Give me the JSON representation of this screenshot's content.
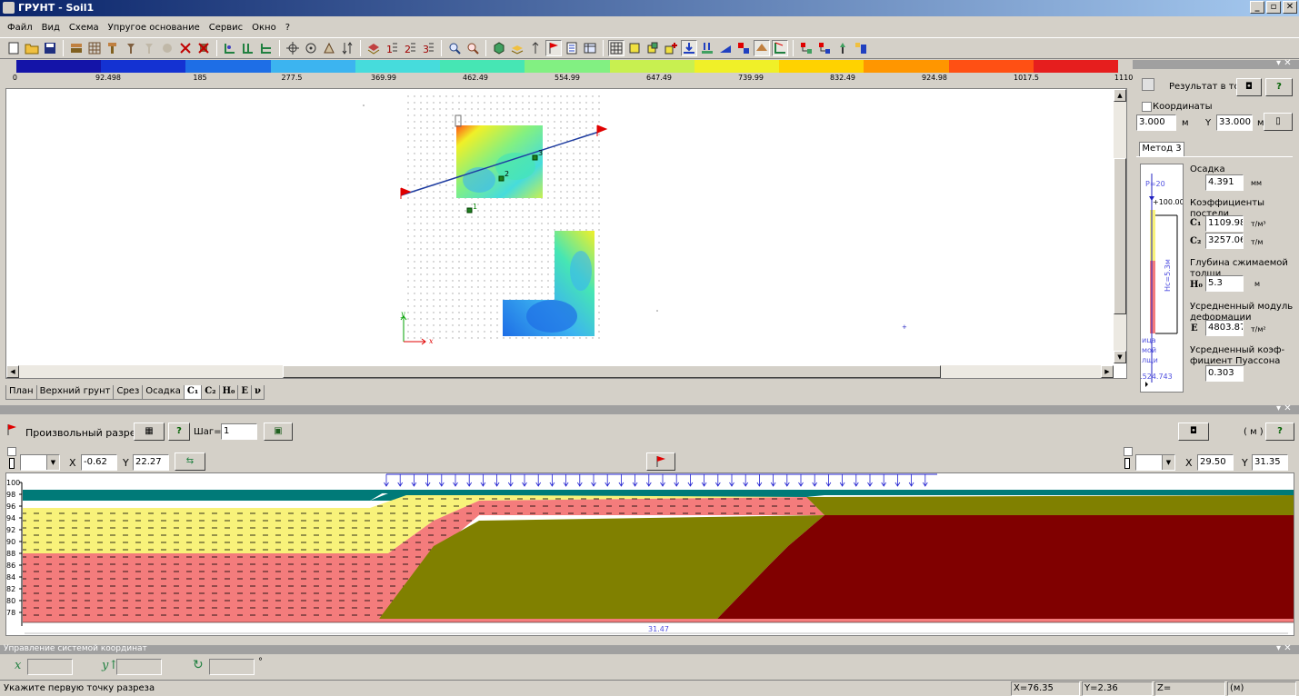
{
  "window": {
    "title": "ГРУНТ - Soil1",
    "min": "_",
    "max": "▫",
    "close": "✕"
  },
  "menu": [
    "Файл",
    "Вид",
    "Схема",
    "Упругое основание",
    "Сервис",
    "Окно",
    "?"
  ],
  "scale": {
    "colors": [
      "#1414a8",
      "#1432d2",
      "#1e6ee6",
      "#3cb4f0",
      "#46dcdc",
      "#46e6b4",
      "#82f082",
      "#c8f050",
      "#f0f028",
      "#ffd200",
      "#ff9600",
      "#ff5014",
      "#e61e1e"
    ],
    "labels": [
      "0",
      "92.498",
      "185",
      "277.5",
      "369.99",
      "462.49",
      "554.99",
      "647.49",
      "739.99",
      "832.49",
      "924.98",
      "1017.5",
      "1110"
    ]
  },
  "plan": {
    "point_labels": [
      "1",
      "2",
      "3"
    ],
    "axis_x": "x",
    "axis_y": "y"
  },
  "tabs_top": [
    "План",
    "Верхний грунт",
    "Срез",
    "Осадка",
    "C₁",
    "C₂",
    "H₀",
    "E",
    "ν"
  ],
  "right_panel": {
    "result_label": "Результат в то",
    "help": "?",
    "coords_label": "Координаты",
    "x_value": "3.000",
    "x_unit": "м",
    "y_label": "Y",
    "y_value": "33.000",
    "y_unit": "м",
    "method_tab": "Метод 3",
    "diagram": {
      "p_label": "P=20",
      "level": "+100.00",
      "hc_label": "Hc=5.3м",
      "lower_text": [
        "ица",
        "мой",
        "лщи"
      ],
      "bottom_value": "9.524.743"
    },
    "settlement_label": "Осадка",
    "settlement_value": "4.391",
    "settlement_unit": "мм",
    "coef_label": "Коэффициенты постели",
    "c1_label": "C₁",
    "c1_value": "1109.981",
    "c1_unit": "т/м³",
    "c2_label": "C₂",
    "c2_value": "3257.064",
    "c2_unit": "т/м",
    "depth_label": "Глубина сжимаемой толщи",
    "h0_label": "H₀",
    "h0_value": "5.3",
    "h0_unit": "м",
    "modulus_label": "Усредненный модуль деформации",
    "e_label": "E",
    "e_value": "4803.876",
    "e_unit": "т/м²",
    "poisson_label": "Усредненный коэф-фициент Пуассона",
    "poisson_value": "0.303"
  },
  "section": {
    "title": "Произвольный разрез",
    "step_label": "Шаг=",
    "step_value": "1",
    "unit_label": "( м )",
    "help": "?",
    "left_x_label": "X",
    "left_x": "-0.62",
    "left_y_label": "Y",
    "left_y": "22.27",
    "right_x_label": "X",
    "right_x": "29.50",
    "right_y_label": "Y",
    "right_y": "31.35",
    "y_ticks": [
      "100",
      "98",
      "96",
      "94",
      "92",
      "90",
      "88",
      "86",
      "84",
      "82",
      "80",
      "78"
    ],
    "length_label": "31.47"
  },
  "coord_panel": {
    "title": "Управление системой координат",
    "deg": "°"
  },
  "status": {
    "message": "Укажите первую точку разреза",
    "x": "X=76.35",
    "y": "Y=2.36",
    "z": "Z=",
    "unit": "(м)"
  },
  "colors": {
    "title_start": "#0a246a",
    "title_end": "#a6caf0",
    "teal_layer": "#007a78",
    "yellow_layer": "#f8f27a",
    "pink_layer": "#f47c7c",
    "olive_layer": "#808000",
    "maroon_layer": "#800000",
    "load_arrow": "#2020d0",
    "section_line": "#1e3ca0"
  }
}
